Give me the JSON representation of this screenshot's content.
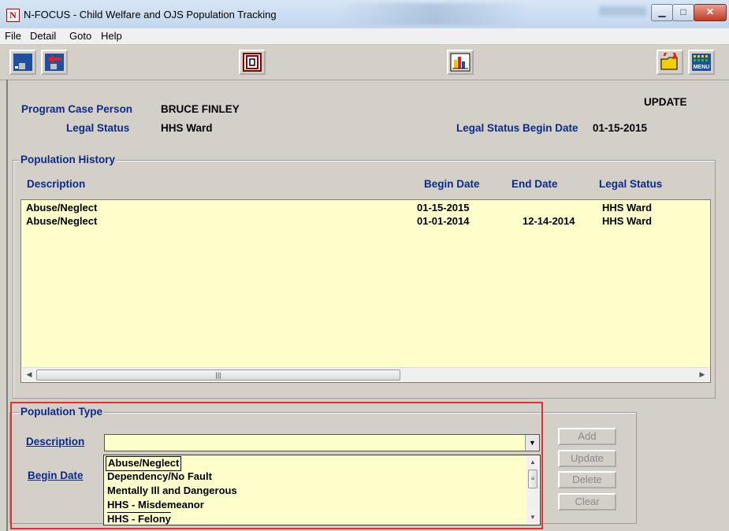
{
  "window": {
    "title": "N-FOCUS - Child Welfare and OJS Population Tracking",
    "app_icon_letter": "N"
  },
  "menu": [
    "File",
    "Detail",
    "Goto",
    "Help"
  ],
  "header": {
    "mode": "UPDATE",
    "program_case_person_label": "Program Case Person",
    "program_case_person_value": "BRUCE FINLEY",
    "legal_status_label": "Legal Status",
    "legal_status_value": "HHS Ward",
    "legal_status_begin_label": "Legal Status Begin Date",
    "legal_status_begin_value": "01-15-2015"
  },
  "population_history": {
    "title": "Population History",
    "columns": {
      "description": "Description",
      "begin": "Begin Date",
      "end": "End Date",
      "legal_status": "Legal Status"
    },
    "rows": [
      {
        "description": "Abuse/Neglect",
        "begin": "01-15-2015",
        "end": "",
        "legal_status": "HHS Ward"
      },
      {
        "description": "Abuse/Neglect",
        "begin": "01-01-2014",
        "end": "12-14-2014",
        "legal_status": "HHS Ward"
      }
    ]
  },
  "population_type": {
    "title": "Population Type",
    "description_label": "Description",
    "begin_date_label": "Begin Date",
    "description_value": "",
    "options": [
      "Abuse/Neglect",
      "Dependency/No Fault",
      "Mentally Ill and Dangerous",
      "HHS - Misdemeanor",
      "HHS - Felony"
    ]
  },
  "actions": {
    "add": "Add",
    "update": "Update",
    "delete": "Delete",
    "clear": "Clear"
  },
  "colors": {
    "label_blue": "#0a2a8a",
    "list_bg": "#ffffcc",
    "highlight": "#e03030"
  }
}
